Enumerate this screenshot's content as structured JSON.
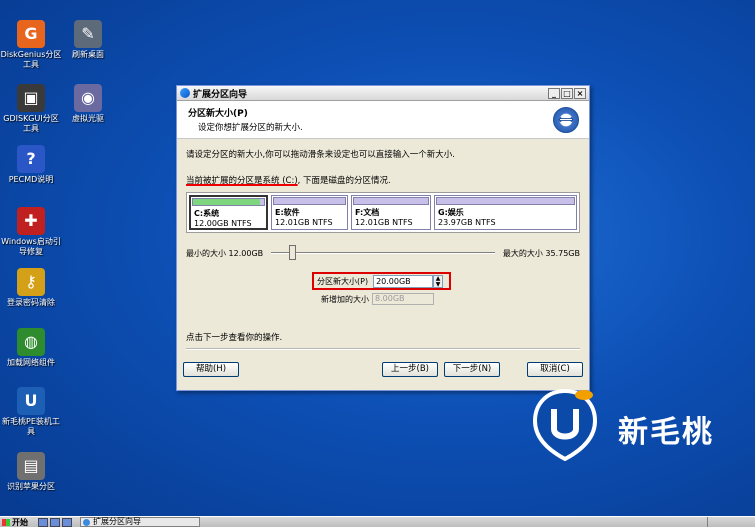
{
  "desktop": {
    "icons": [
      {
        "label": "DiskGenius分区工具",
        "glyph": "G",
        "color": "#e8651e",
        "icon": "diskgenius-icon"
      },
      {
        "label": "刷新桌面",
        "glyph": "✎",
        "color": "#5c6a7a",
        "icon": "refresh-desktop-icon"
      },
      {
        "label": "GDISKGUI分区工具",
        "glyph": "▣",
        "color": "#3a3a3a",
        "icon": "gdisk-icon"
      },
      {
        "label": "虚拟光驱",
        "glyph": "◉",
        "color": "#6a6aa0",
        "icon": "virtual-drive-icon"
      },
      {
        "label": "PECMD说明",
        "glyph": "?",
        "color": "#2a56c6",
        "icon": "help-icon"
      },
      {
        "label": "Windows启动引导修复",
        "glyph": "✚",
        "color": "#c02020",
        "icon": "boot-repair-icon"
      },
      {
        "label": "登录密码清除",
        "glyph": "⚷",
        "color": "#d4a017",
        "icon": "key-icon"
      },
      {
        "label": "加载网络组件",
        "glyph": "◍",
        "color": "#2e8b2e",
        "icon": "network-icon"
      },
      {
        "label": "新毛桃PE装机工具",
        "glyph": "U",
        "color": "#1d5fb5",
        "icon": "installer-icon"
      },
      {
        "label": "识别苹果分区",
        "glyph": "▤",
        "color": "#707070",
        "icon": "apple-partition-icon"
      }
    ]
  },
  "window": {
    "title": "扩展分区向导",
    "min": "_",
    "max": "□",
    "close": "×",
    "header_title": "分区新大小(P)",
    "header_subtitle": "设定你想扩展分区的新大小.",
    "line1": "请设定分区的新大小,你可以拖动滑条来设定也可以直接输入一个新大小.",
    "line2_highlight": "当前被扩展的分区是系统 (C:)",
    "line2_rest": ", 下面是磁盘的分区情况.",
    "partitions": [
      {
        "name": "C:系统",
        "size": "12.00GB NTFS",
        "fill": 0.95
      },
      {
        "name": "E:软件",
        "size": "12.01GB NTFS",
        "fill": 0.0
      },
      {
        "name": "F:文档",
        "size": "12.01GB NTFS",
        "fill": 0.0
      },
      {
        "name": "G:娱乐",
        "size": "23.97GB NTFS",
        "fill": 0.0
      }
    ],
    "min_label": "最小的大小 12.00GB",
    "max_label": "最大的大小 35.75GB",
    "new_size_label": "分区新大小(P)",
    "new_size_value": "20.00GB",
    "added_label": "新增加的大小",
    "added_value": "8.00GB",
    "hint": "点击下一步查看你的操作.",
    "buttons": {
      "help": "帮助(H)",
      "back": "上一步(B)",
      "next": "下一步(N)",
      "cancel": "取消(C)"
    }
  },
  "logo": {
    "brand": "新毛桃"
  },
  "taskbar": {
    "start": "开始",
    "task": "扩展分区向导"
  }
}
